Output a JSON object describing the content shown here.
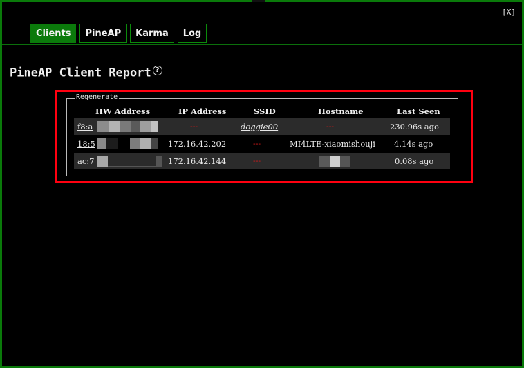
{
  "window": {
    "close_label": "[X]"
  },
  "tabs": [
    {
      "label": "Clients",
      "active": true
    },
    {
      "label": "PineAP",
      "active": false
    },
    {
      "label": "Karma",
      "active": false
    },
    {
      "label": "Log",
      "active": false
    }
  ],
  "report": {
    "title": "PineAP Client Report",
    "help_glyph": "?",
    "regenerate_label": "Regenerate",
    "columns": [
      "HW Address",
      "IP Address",
      "SSID",
      "Hostname",
      "Last Seen"
    ],
    "rows": [
      {
        "hw": "f8:a",
        "ip": "---",
        "ssid": "doggie00",
        "hostname": "---",
        "last_seen": "230.96s ago"
      },
      {
        "hw": "18:5",
        "ip": "172.16.42.202",
        "ssid": "---",
        "hostname": "MI4LTE-xiaomishouji",
        "last_seen": "4.14s ago"
      },
      {
        "hw": "ac:7",
        "ip": "172.16.42.144",
        "ssid": "---",
        "hostname": "",
        "last_seen": "0.08s ago"
      }
    ]
  },
  "colors": {
    "accent_green": "#0b7a0b",
    "highlight_red": "#ff0010",
    "row_shade": "#2b2b2b",
    "dash_red": "#d01818"
  }
}
